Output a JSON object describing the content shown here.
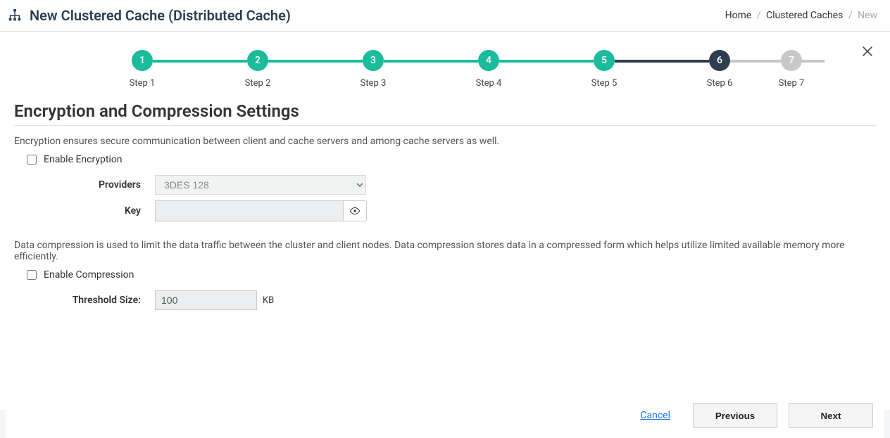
{
  "header": {
    "title": "New Clustered Cache (Distributed Cache)"
  },
  "breadcrumb": {
    "home": "Home",
    "caches": "Clustered Caches",
    "current": "New"
  },
  "stepper": {
    "steps": [
      {
        "num": "1",
        "label": "Step 1",
        "state": "done",
        "lineAfter": "done"
      },
      {
        "num": "2",
        "label": "Step 2",
        "state": "done",
        "lineAfter": "done"
      },
      {
        "num": "3",
        "label": "Step 3",
        "state": "done",
        "lineAfter": "done"
      },
      {
        "num": "4",
        "label": "Step 4",
        "state": "done",
        "lineAfter": "done"
      },
      {
        "num": "5",
        "label": "Step 5",
        "state": "done",
        "lineAfter": "current"
      },
      {
        "num": "6",
        "label": "Step 6",
        "state": "current",
        "lineAfter": "pending"
      },
      {
        "num": "7",
        "label": "Step 7",
        "state": "pending",
        "lineAfter": ""
      }
    ]
  },
  "section": {
    "title": "Encryption and Compression Settings"
  },
  "encryption": {
    "desc": "Encryption ensures secure communication between client and cache servers and among cache servers as well.",
    "enable_label": "Enable Encryption",
    "providers_label": "Providers",
    "provider_value": "3DES 128",
    "key_label": "Key",
    "key_value": ""
  },
  "compression": {
    "desc": "Data compression is used to limit the data traffic between the cluster and client nodes. Data compression stores data in a compressed form which helps utilize limited available memory more efficiently.",
    "enable_label": "Enable Compression",
    "threshold_label": "Threshold Size:",
    "threshold_value": "100",
    "threshold_unit": "KB"
  },
  "footer": {
    "cancel": "Cancel",
    "previous": "Previous",
    "next": "Next"
  }
}
